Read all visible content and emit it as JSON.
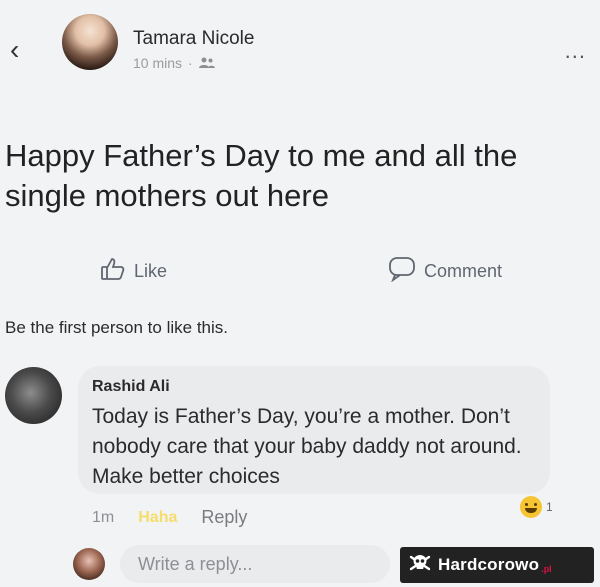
{
  "header": {
    "author": "Tamara Nicole",
    "time": "10 mins",
    "separator": "·",
    "more": "..."
  },
  "post": {
    "text": "Happy Father’s Day to me and all the single mothers out here"
  },
  "actions": {
    "like": "Like",
    "comment": "Comment"
  },
  "likes_summary": "Be the first person to like this.",
  "comment": {
    "author": "Rashid Ali",
    "text": "Today is Father’s Day, you’re a mother. Don’t nobody care that your baby daddy not around. Make better choices",
    "time": "1m",
    "haha": "Haha",
    "reply": "Reply",
    "reaction_count": "1"
  },
  "reply_box": {
    "placeholder": "Write a reply..."
  },
  "watermark": {
    "text": "Hardcorowo",
    "suffix": ".pl"
  },
  "colors": {
    "background": "#f2f3f5",
    "bubble": "#eaebed",
    "haha": "#f5dd6a"
  }
}
